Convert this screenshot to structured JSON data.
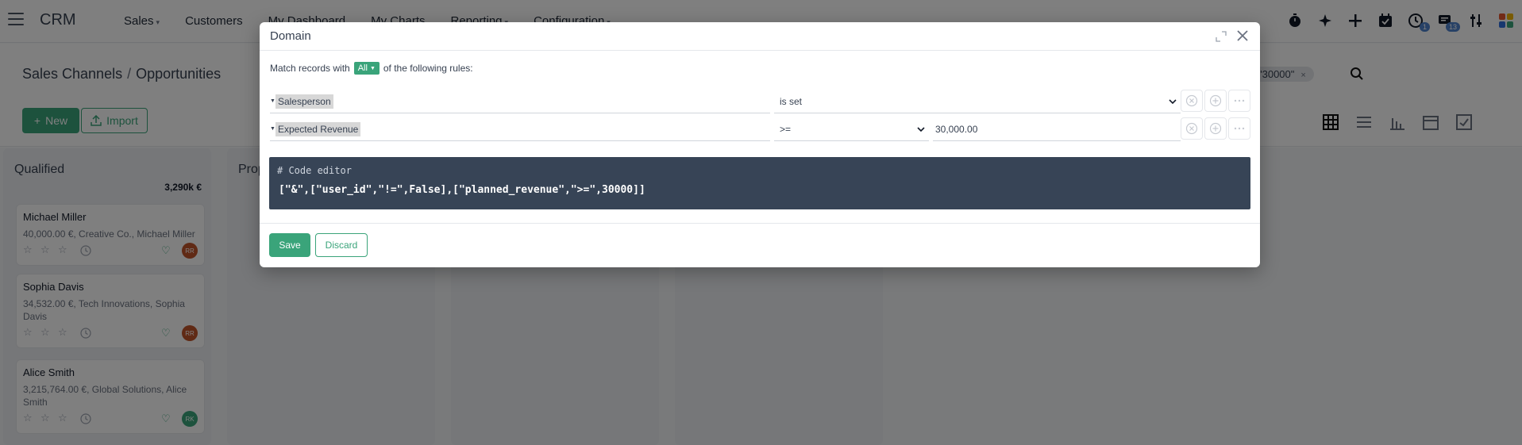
{
  "navbar": {
    "brand": "CRM",
    "menu": [
      {
        "label": "Sales",
        "dropdown": true
      },
      {
        "label": "Customers",
        "dropdown": false
      },
      {
        "label": "My Dashboard",
        "dropdown": false
      },
      {
        "label": "My Charts",
        "dropdown": false
      },
      {
        "label": "Reporting",
        "dropdown": true
      },
      {
        "label": "Configuration",
        "dropdown": true
      }
    ],
    "systray": [
      {
        "icon": "stopwatch-icon"
      },
      {
        "icon": "sparkle-icon"
      },
      {
        "icon": "plus-icon"
      },
      {
        "icon": "calendar-check-icon"
      },
      {
        "icon": "clock-activity-icon",
        "badge": "1"
      },
      {
        "icon": "chat-icon",
        "badge": "13"
      },
      {
        "icon": "sliders-icon"
      },
      {
        "icon": "apps-icon"
      }
    ]
  },
  "control_panel": {
    "breadcrumb": [
      "Sales Channels",
      "Opportunities"
    ],
    "new_label": "New",
    "import_label": "Import",
    "facet": "\"30000\"",
    "facet_remove": "×"
  },
  "kanban": {
    "columns": [
      {
        "title": "Qualified",
        "total": "3,290k €",
        "cards": [
          {
            "name": "Michael Miller",
            "sub": "40,000.00 €, Creative Co., Michael Miller",
            "avatar": "RR",
            "avatar_color": "#c0542b"
          },
          {
            "name": "Sophia Davis",
            "sub": "34,532.00 €, Tech Innovations, Sophia Davis",
            "avatar": "RR",
            "avatar_color": "#c0542b"
          },
          {
            "name": "Alice Smith",
            "sub": "3,215,764.00 €, Global Solutions, Alice Smith",
            "avatar": "RK",
            "avatar_color": "#3aa47a"
          }
        ]
      },
      {
        "title": "Prop",
        "total": "",
        "cards": []
      },
      {
        "title": "",
        "total": "",
        "cards": []
      },
      {
        "title": "",
        "total": "",
        "cards": []
      }
    ]
  },
  "modal": {
    "title": "Domain",
    "match_prefix": "Match records with",
    "match_value": "All",
    "match_suffix": "of the following rules:",
    "rules": [
      {
        "path": "Salesperson",
        "operator": "is set",
        "value": ""
      },
      {
        "path": "Expected Revenue",
        "operator": ">=",
        "value": "30,000.00"
      }
    ],
    "code_comment": "# Code editor",
    "code": "[\"&\",[\"user_id\",\"!=\",False],[\"planned_revenue\",\">=\",30000]]",
    "save_label": "Save",
    "discard_label": "Discard"
  },
  "colors": {
    "accent": "#3aa47a",
    "code_bg": "#374456",
    "overlay": "rgba(0,0,0,0.5)"
  }
}
